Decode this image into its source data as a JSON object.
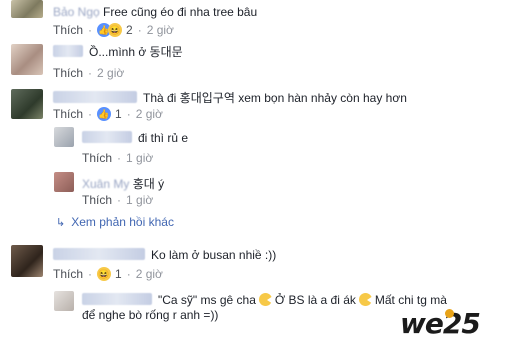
{
  "labels": {
    "like": "Thích",
    "separator": "·"
  },
  "comments": [
    {
      "name_hint": "Bảo Ngọ",
      "text": "Free cũng éo đi nha tree bâu",
      "reactions": "2",
      "time": "2 giờ"
    },
    {
      "text": "Ồ...mình ở 동대문",
      "time": "2 giờ"
    },
    {
      "text": "Thà đi 홍대입구역 xem bọn hàn nhảy còn hay hơn",
      "likes": "1",
      "time": "2 giờ"
    },
    {
      "text": "đi thì rủ e",
      "time": "1 giờ"
    },
    {
      "name_hint": "Xuân My",
      "text": "홍대 ý",
      "time": "1 giờ"
    },
    {
      "text": "Ko làm ở busan nhiề :))",
      "reactions": "1",
      "time": "2 giờ"
    },
    {
      "text_line1": "\"Ca sỹ\" ms gê cha",
      "text_mid": "Ở BS là a đi ák",
      "text_end": "Mất chi tg mà",
      "text_line2": "để nghe bò rống r anh =))"
    }
  ],
  "more_replies": "Xem phản hồi khác",
  "watermark": {
    "brand": "we",
    "num": "25"
  },
  "colors": {
    "link": "#4267b2",
    "meta": "#90949c",
    "like_icon": "#5890ff",
    "haha_icon": "#f7c948"
  },
  "icons": {
    "like": "thumbs-up-icon",
    "haha": "laughing-emoji-icon",
    "reply": "reply-arrow-icon",
    "pacman": "pacman-emoji-icon"
  }
}
